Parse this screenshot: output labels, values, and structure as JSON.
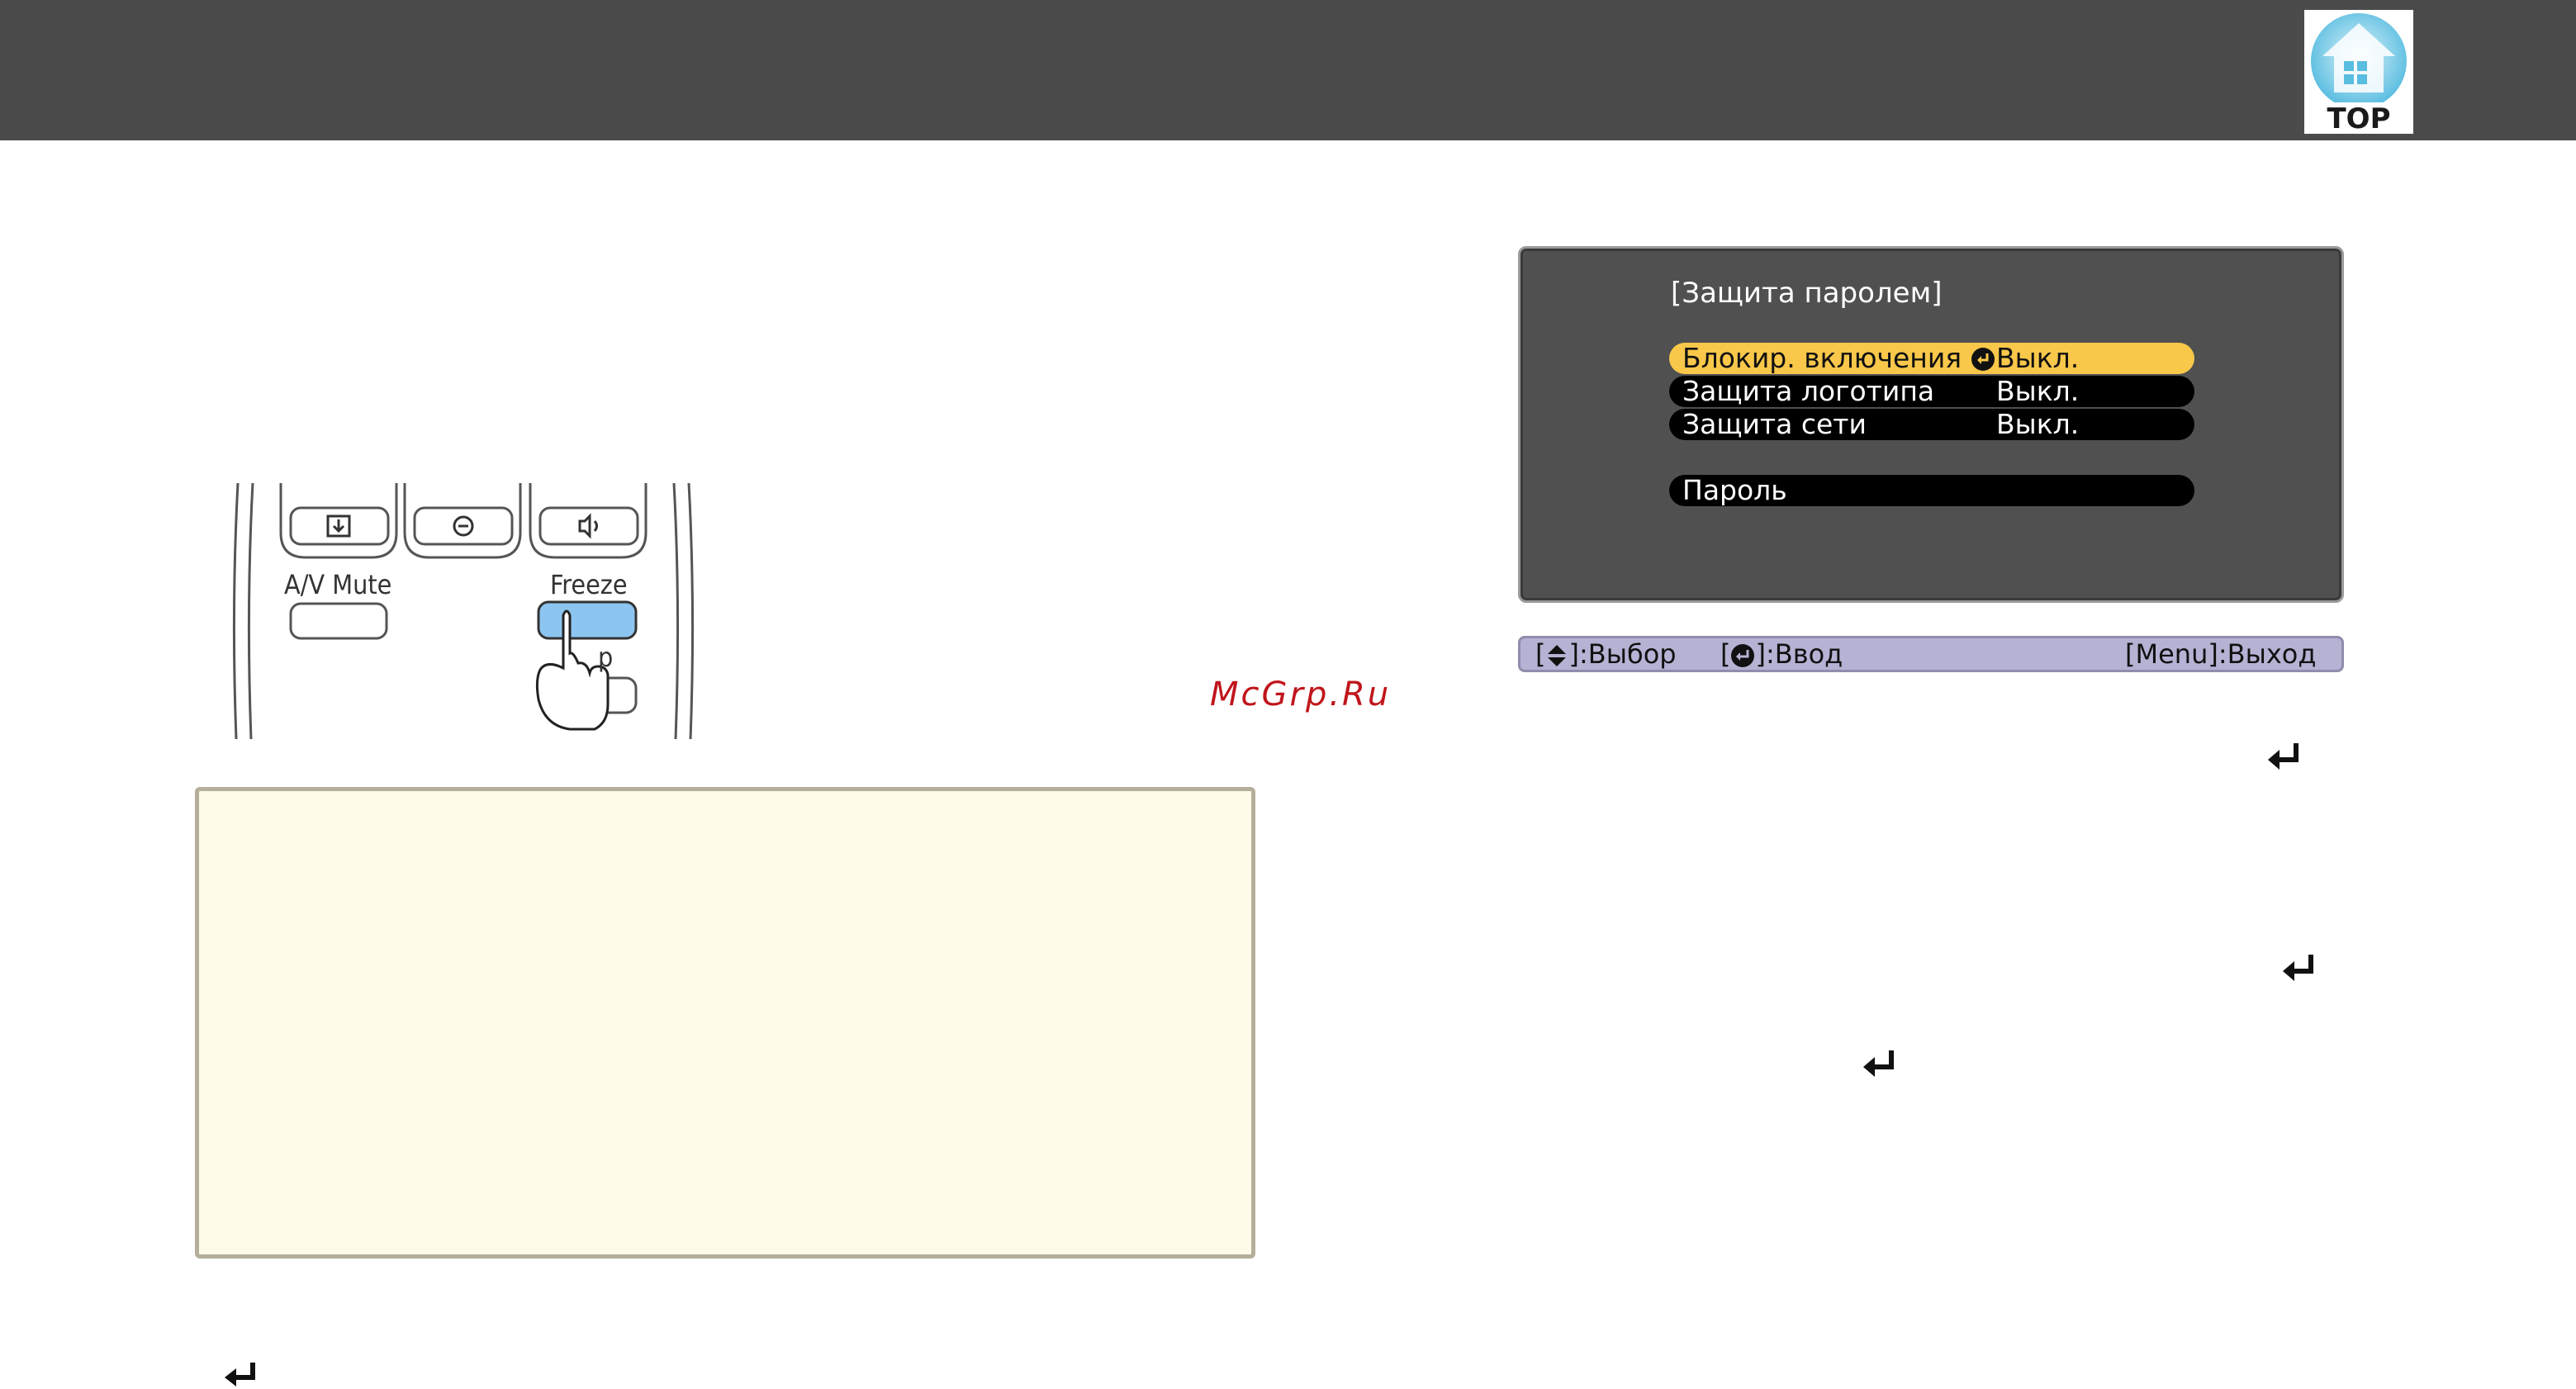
{
  "header": {
    "top_button_label": "TOP"
  },
  "remote": {
    "av_mute_label": "A/V Mute",
    "freeze_label": "Freeze",
    "partial_label": "p"
  },
  "watermark": "McGrp.Ru",
  "osd": {
    "title": "[Защита паролем]",
    "rows": [
      {
        "label": "Блокир. включения",
        "value": "Выкл.",
        "selected": true
      },
      {
        "label": "Защита логотипа",
        "value": "Выкл.",
        "selected": false
      },
      {
        "label": "Защита сети",
        "value": "Выкл.",
        "selected": false
      },
      {
        "label": "Пароль",
        "value": "",
        "selected": false
      }
    ],
    "bar": {
      "select": ":Выбор",
      "enter": ":Ввод",
      "exit": "[Menu]:Выход"
    }
  },
  "icons": {
    "return_icon": "return-arrow-icon",
    "top_icon": "home-icon"
  },
  "colors": {
    "header_bg": "#4b4b4b",
    "note_bg": "#fefbea",
    "osd_highlight": "#f9c84a",
    "watermark": "#c0151b",
    "freeze_button": "#8cc6f0"
  }
}
